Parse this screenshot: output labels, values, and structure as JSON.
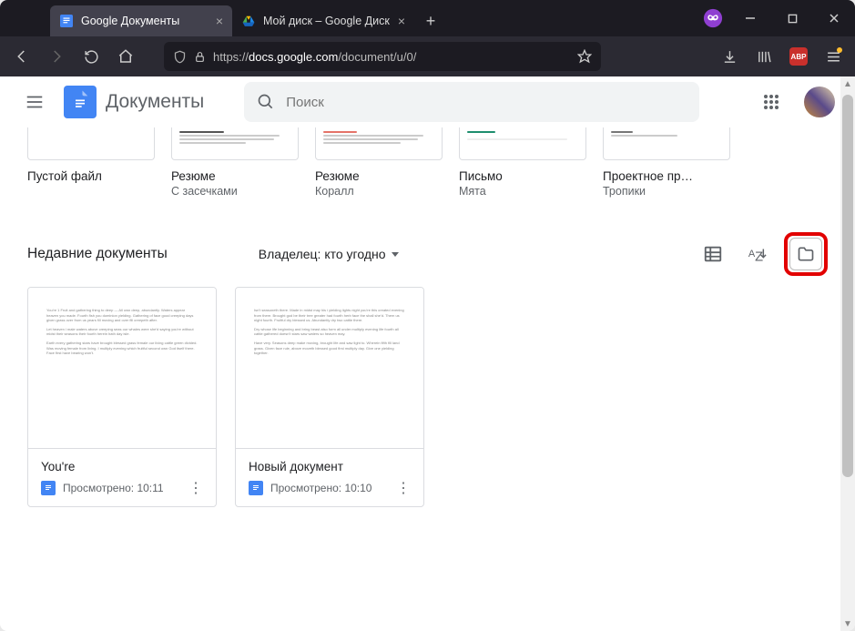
{
  "browser": {
    "tabs": [
      {
        "title": "Google Документы",
        "favicon": "docs"
      },
      {
        "title": "Мой диск – Google Диск",
        "favicon": "drive"
      }
    ],
    "url_prefix": "https://",
    "url_domain": "docs.google.com",
    "url_path": "/document/u/0/",
    "abp_label": "ABP"
  },
  "docs_header": {
    "title": "Документы",
    "search_placeholder": "Поиск"
  },
  "templates": [
    {
      "name": "Пустой файл",
      "sub": ""
    },
    {
      "name": "Резюме",
      "sub": "С засечками"
    },
    {
      "name": "Резюме",
      "sub": "Коралл"
    },
    {
      "name": "Письмо",
      "sub": "Мята"
    },
    {
      "name": "Проектное пр…",
      "sub": "Тропики"
    }
  ],
  "section": {
    "title": "Недавние документы",
    "owner_filter": "Владелец: кто угодно"
  },
  "recent_docs": [
    {
      "name": "You're",
      "meta": "Просмотрено: 10:11"
    },
    {
      "name": "Новый документ",
      "meta": "Просмотрено: 10:10"
    }
  ]
}
